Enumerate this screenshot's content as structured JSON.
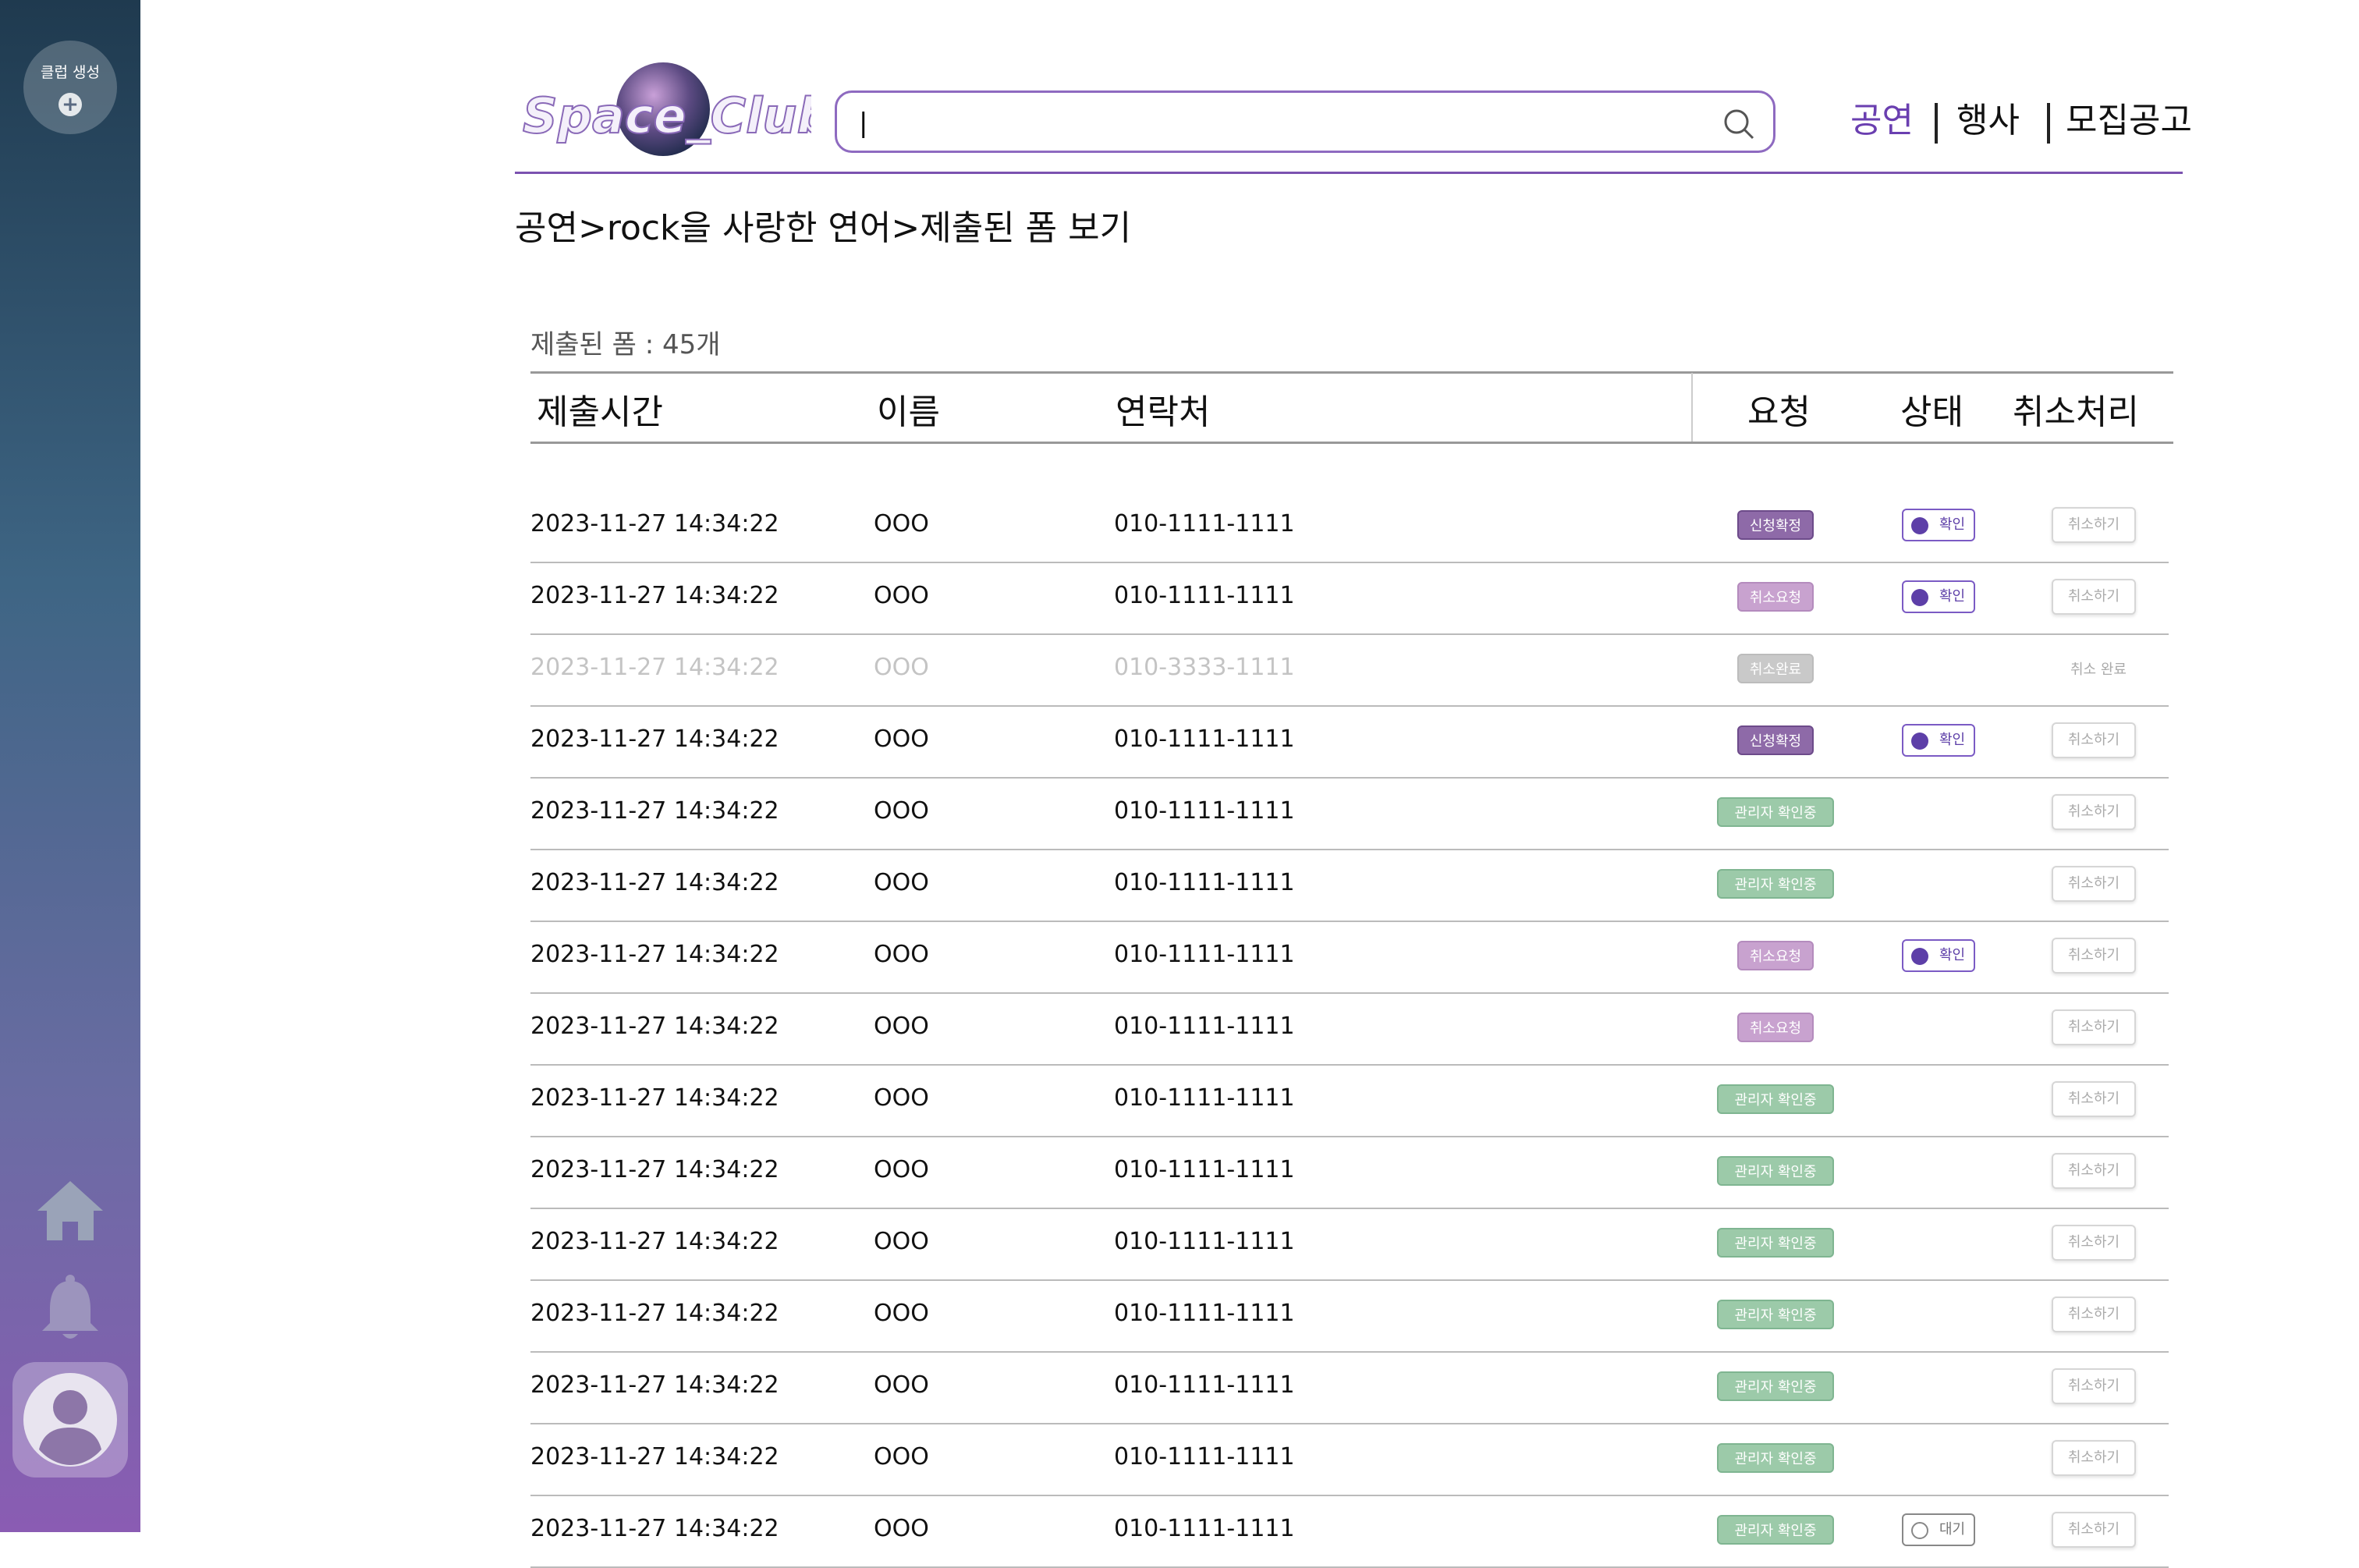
{
  "sidebar": {
    "create_club_label": "클럽 생성",
    "plus": "+"
  },
  "header": {
    "logo_text": "Space_Club",
    "search_value": "|",
    "nav": [
      "공연",
      "행사",
      "모집공고"
    ],
    "colors": {
      "accent": "#7b52b0",
      "active_nav": "#6a3fb0"
    }
  },
  "breadcrumb": "공연>rock을 사랑한 연어>제출된 폼 보기",
  "count_text": "제출된 폼 : 45개",
  "table": {
    "headers": [
      "제출시간",
      "이름",
      "연락처",
      "요청",
      "상태",
      "취소처리"
    ],
    "rows": [
      {
        "time": "2023-11-27 14:34:22",
        "name": "OOO",
        "phone": "010-1111-1111",
        "request": "신청확정",
        "request_type": "confirm",
        "status": "확인",
        "cancel": "취소하기"
      },
      {
        "time": "2023-11-27 14:34:22",
        "name": "OOO",
        "phone": "010-1111-1111",
        "request": "취소요청",
        "request_type": "cancelreq",
        "status": "확인",
        "cancel": "취소하기"
      },
      {
        "time": "2023-11-27 14:34:22",
        "name": "OOO",
        "phone": "010-3333-1111",
        "request": "취소완료",
        "request_type": "canceldone",
        "status": "",
        "cancel": "취소 완료",
        "faded": true
      },
      {
        "time": "2023-11-27 14:34:22",
        "name": "OOO",
        "phone": "010-1111-1111",
        "request": "신청확정",
        "request_type": "confirm",
        "status": "확인",
        "cancel": "취소하기"
      },
      {
        "time": "2023-11-27 14:34:22",
        "name": "OOO",
        "phone": "010-1111-1111",
        "request": "관리자 확인중",
        "request_type": "admin",
        "status": "",
        "cancel": "취소하기"
      },
      {
        "time": "2023-11-27 14:34:22",
        "name": "OOO",
        "phone": "010-1111-1111",
        "request": "관리자 확인중",
        "request_type": "admin",
        "status": "",
        "cancel": "취소하기"
      },
      {
        "time": "2023-11-27 14:34:22",
        "name": "OOO",
        "phone": "010-1111-1111",
        "request": "취소요청",
        "request_type": "cancelreq",
        "status": "확인",
        "cancel": "취소하기"
      },
      {
        "time": "2023-11-27 14:34:22",
        "name": "OOO",
        "phone": "010-1111-1111",
        "request": "취소요청",
        "request_type": "cancelreq",
        "status": "",
        "cancel": "취소하기"
      },
      {
        "time": "2023-11-27 14:34:22",
        "name": "OOO",
        "phone": "010-1111-1111",
        "request": "관리자 확인중",
        "request_type": "admin",
        "status": "",
        "cancel": "취소하기"
      },
      {
        "time": "2023-11-27 14:34:22",
        "name": "OOO",
        "phone": "010-1111-1111",
        "request": "관리자 확인중",
        "request_type": "admin",
        "status": "",
        "cancel": "취소하기"
      },
      {
        "time": "2023-11-27 14:34:22",
        "name": "OOO",
        "phone": "010-1111-1111",
        "request": "관리자 확인중",
        "request_type": "admin",
        "status": "",
        "cancel": "취소하기"
      },
      {
        "time": "2023-11-27 14:34:22",
        "name": "OOO",
        "phone": "010-1111-1111",
        "request": "관리자 확인중",
        "request_type": "admin",
        "status": "",
        "cancel": "취소하기"
      },
      {
        "time": "2023-11-27 14:34:22",
        "name": "OOO",
        "phone": "010-1111-1111",
        "request": "관리자 확인중",
        "request_type": "admin",
        "status": "",
        "cancel": "취소하기"
      },
      {
        "time": "2023-11-27 14:34:22",
        "name": "OOO",
        "phone": "010-1111-1111",
        "request": "관리자 확인중",
        "request_type": "admin",
        "status": "",
        "cancel": "취소하기"
      },
      {
        "time": "2023-11-27 14:34:22",
        "name": "OOO",
        "phone": "010-1111-1111",
        "request": "관리자 확인중",
        "request_type": "admin",
        "status": "대기",
        "status_type": "wait",
        "cancel": "취소하기"
      }
    ]
  },
  "icons": [
    "plus-icon",
    "home-icon",
    "bell-icon",
    "avatar-icon",
    "search-icon",
    "check-circle-icon"
  ]
}
